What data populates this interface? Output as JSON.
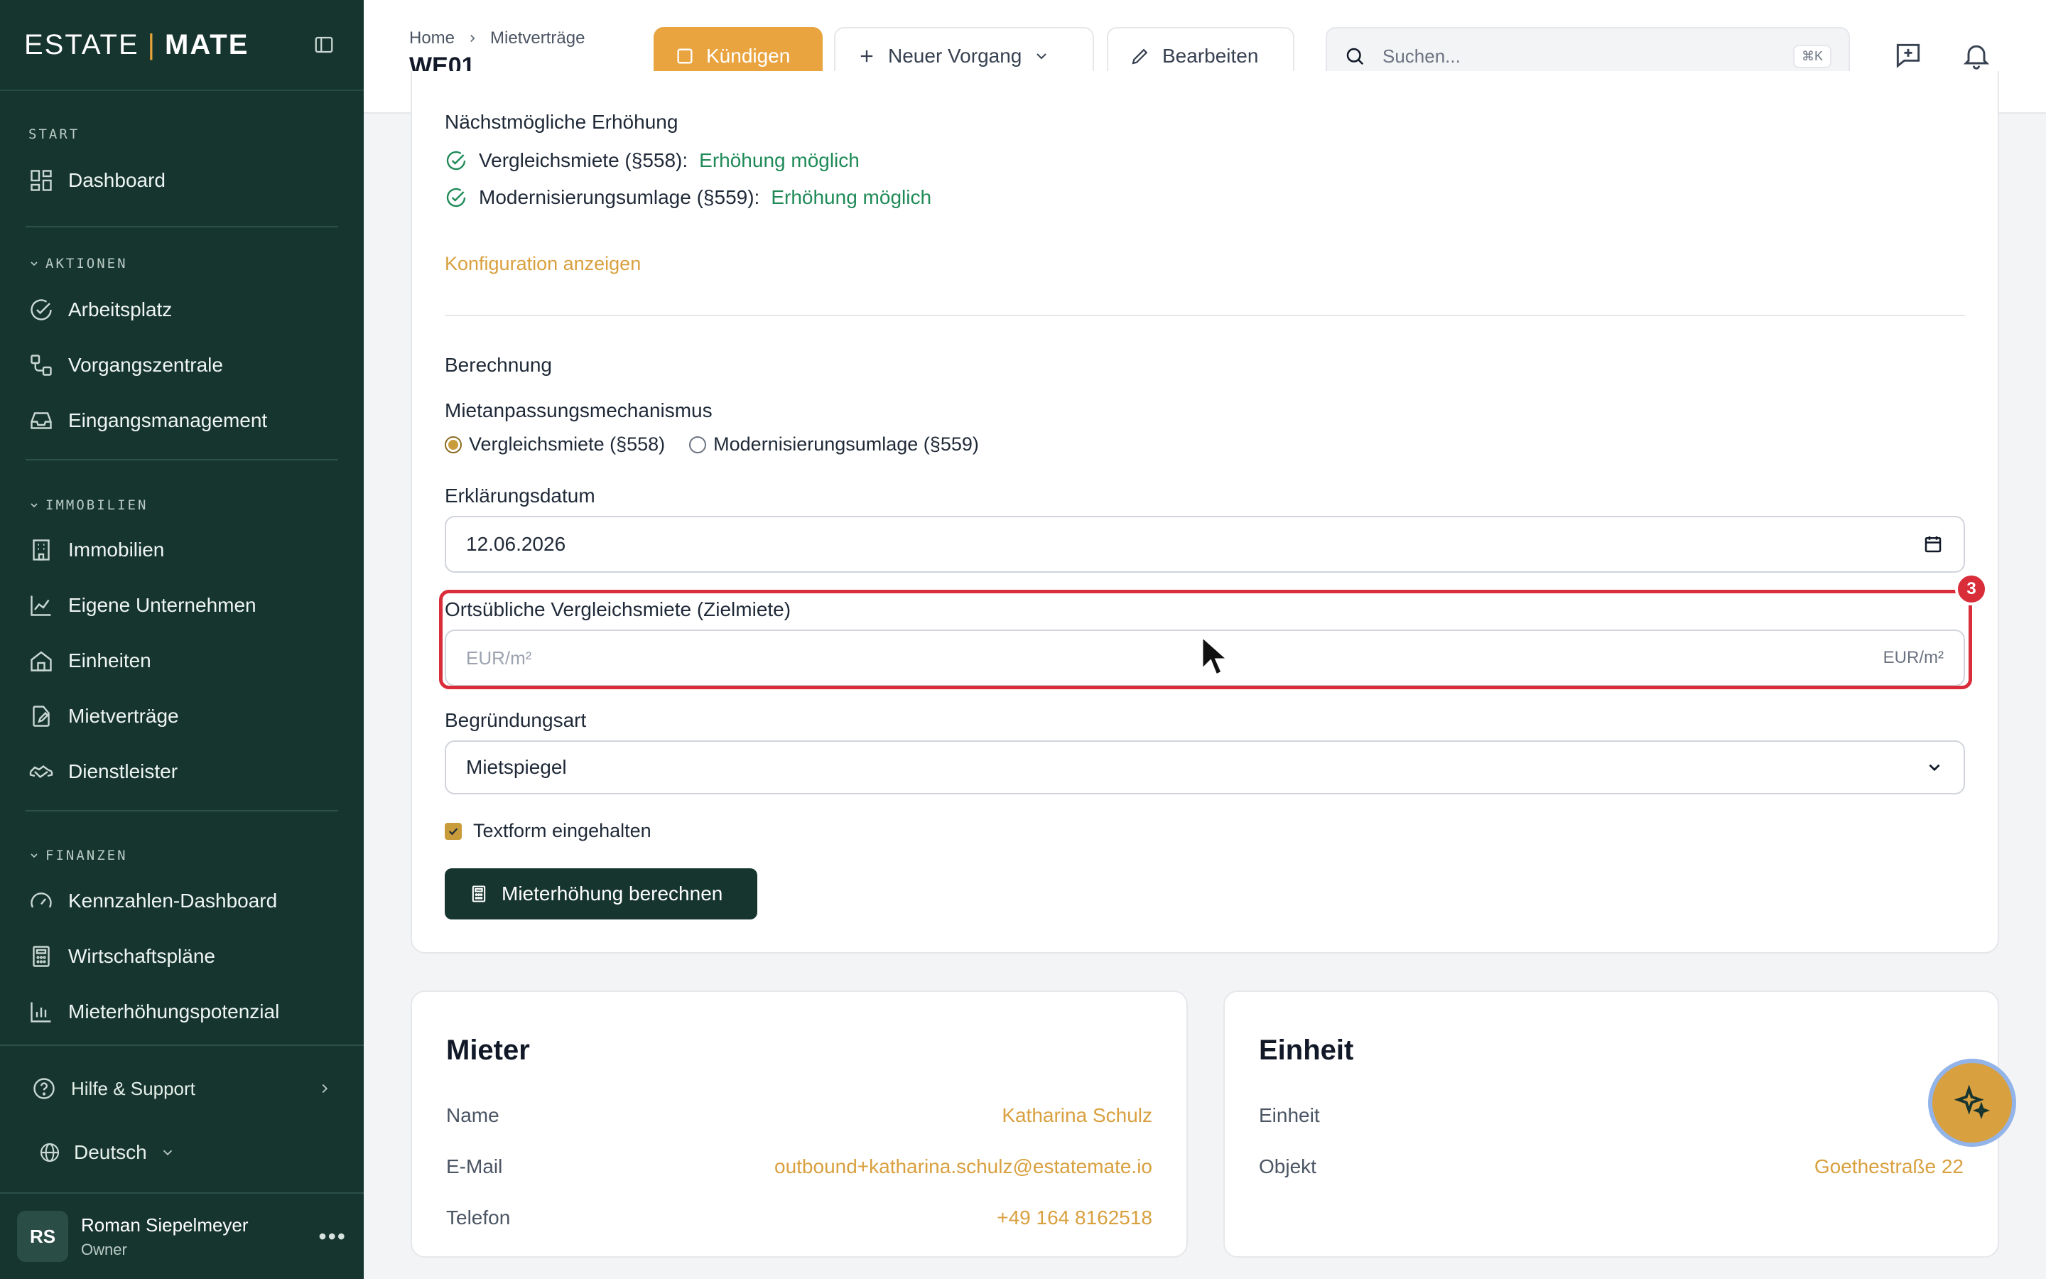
{
  "brand": {
    "left": "ESTATE",
    "sep": "|",
    "right": "MATE"
  },
  "sidebar": {
    "start_label": "START",
    "dashboard": "Dashboard",
    "sections": [
      {
        "label": "AKTIONEN",
        "items": [
          "Arbeitsplatz",
          "Vorgangszentrale",
          "Eingangsmanagement"
        ]
      },
      {
        "label": "IMMOBILIEN",
        "items": [
          "Immobilien",
          "Eigene Unternehmen",
          "Einheiten",
          "Mietverträge",
          "Dienstleister"
        ]
      },
      {
        "label": "FINANZEN",
        "items": [
          "Kennzahlen-Dashboard",
          "Wirtschaftspläne",
          "Mieterhöhungspotenzial"
        ]
      }
    ],
    "help": "Hilfe & Support",
    "language": "Deutsch",
    "user": {
      "initials": "RS",
      "name": "Roman Siepelmeyer",
      "role": "Owner"
    }
  },
  "header": {
    "breadcrumb": [
      "Home",
      "Mietverträge"
    ],
    "title": "WE01",
    "cancel_label": "Kündigen",
    "new_label": "Neuer Vorgang",
    "edit_label": "Bearbeiten",
    "search_placeholder": "Suchen...",
    "search_shortcut": "⌘K"
  },
  "increase": {
    "title": "Nächstmögliche Erhöhung",
    "rows": [
      {
        "label": "Vergleichsmiete (§558):",
        "status": "Erhöhung möglich"
      },
      {
        "label": "Modernisierungsumlage (§559):",
        "status": "Erhöhung möglich"
      }
    ],
    "config_link": "Konfiguration anzeigen"
  },
  "calculation": {
    "title": "Berechnung",
    "mechanism_label": "Mietanpassungsmechanismus",
    "mechanism_options": [
      "Vergleichsmiete (§558)",
      "Modernisierungsumlage (§559)"
    ],
    "mechanism_selected": "Vergleichsmiete (§558)",
    "date_label": "Erklärungsdatum",
    "date_value": "12.06.2026",
    "target_label": "Ortsübliche Vergleichsmiete (Zielmiete)",
    "target_placeholder": "EUR/m²",
    "target_unit": "EUR/m²",
    "highlight_badge": "3",
    "reason_label": "Begründungsart",
    "reason_value": "Mietspiegel",
    "textform_label": "Textform eingehalten",
    "textform_checked": true,
    "calc_button": "Mieterhöhung berechnen"
  },
  "tenant": {
    "title": "Mieter",
    "rows": [
      {
        "key": "Name",
        "value": "Katharina Schulz"
      },
      {
        "key": "E-Mail",
        "value": "outbound+katharina.schulz@estatemate.io"
      },
      {
        "key": "Telefon",
        "value": "+49 164 8162518"
      }
    ]
  },
  "unit": {
    "title": "Einheit",
    "rows": [
      {
        "key": "Einheit",
        "value": "W"
      },
      {
        "key": "Objekt",
        "value": "Goethestraße 22"
      }
    ]
  },
  "colors": {
    "sidebar": "#17352f",
    "accent": "#e9a440",
    "success": "#1f8a57",
    "highlight": "#d92d3a"
  }
}
